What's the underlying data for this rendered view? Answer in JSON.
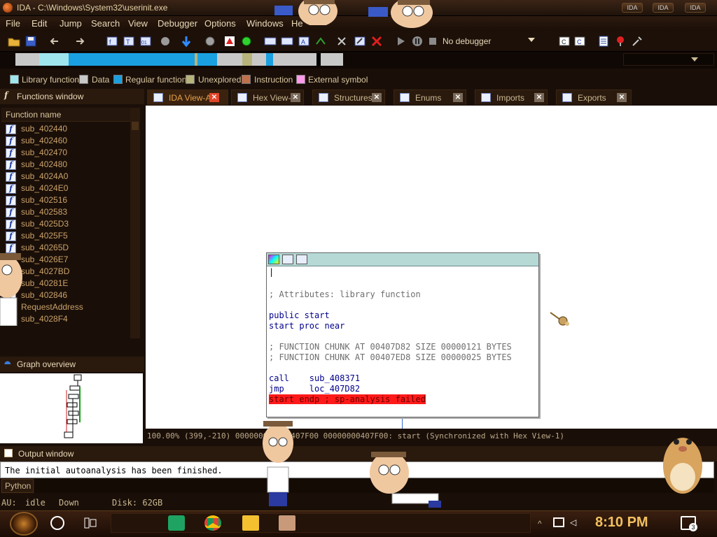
{
  "window": {
    "title": "IDA - C:\\Windows\\System32\\userinit.exe",
    "controls": [
      "IDA",
      "IDA",
      "IDA"
    ]
  },
  "menu": [
    "File",
    "Edit",
    "Jump",
    "Search",
    "View",
    "Debugger",
    "Options",
    "Windows",
    "He"
  ],
  "toolbar": {
    "debugger_label": "No debugger"
  },
  "legend": [
    {
      "label": "Library function",
      "color": "#9fe5ee"
    },
    {
      "label": "Data",
      "color": "#c8c8c8"
    },
    {
      "label": "Regular function",
      "color": "#1aa0e0"
    },
    {
      "label": "Unexplored",
      "color": "#b8b37a"
    },
    {
      "label": "Instruction",
      "color": "#c0704a"
    },
    {
      "label": "External symbol",
      "color": "#ff9aec"
    }
  ],
  "functions_window": {
    "title": "Functions window",
    "column": "Function name",
    "items": [
      "sub_402440",
      "sub_402460",
      "sub_402470",
      "sub_402480",
      "sub_4024A0",
      "sub_4024E0",
      "sub_402516",
      "sub_402583",
      "sub_4025D3",
      "sub_4025F5",
      "sub_40265D",
      "sub_4026E7",
      "sub_4027BD",
      "sub_40281E",
      "sub_402846",
      "RequestAddress",
      "sub_4028F4"
    ]
  },
  "graph_overview": {
    "title": "Graph overview"
  },
  "tabs": [
    {
      "label": "IDA View-A",
      "active": true
    },
    {
      "label": "Hex View-1",
      "active": false
    },
    {
      "label": "Structures",
      "active": false
    },
    {
      "label": "Enums",
      "active": false
    },
    {
      "label": "Imports",
      "active": false
    },
    {
      "label": "Exports",
      "active": false
    }
  ],
  "code": {
    "cursor": "|",
    "attr": "; Attributes: library function",
    "public": "public start",
    "proc": "start proc near",
    "chunk1": "; FUNCTION CHUNK AT 00407D82 SIZE 00000121 BYTES",
    "chunk2": "; FUNCTION CHUNK AT 00407ED8 SIZE 00000025 BYTES",
    "call": "call    sub_408371",
    "jmp": "jmp     loc_407D82",
    "endp": "start endp ; sp-analysis failed"
  },
  "status_line": "100.00% (399,-210)  000000000000407F00 00000000407F00: start (Synchronized with Hex View-1)",
  "output_window": {
    "title": "Output window",
    "text": "The initial autoanalysis has been finished."
  },
  "python_button": "Python",
  "statusbar": {
    "au": "AU:",
    "state": "idle",
    "direction": "Down",
    "disk": "Disk: 62GB"
  },
  "taskbar": {
    "time": "8:10 PM",
    "notifications": "3"
  }
}
